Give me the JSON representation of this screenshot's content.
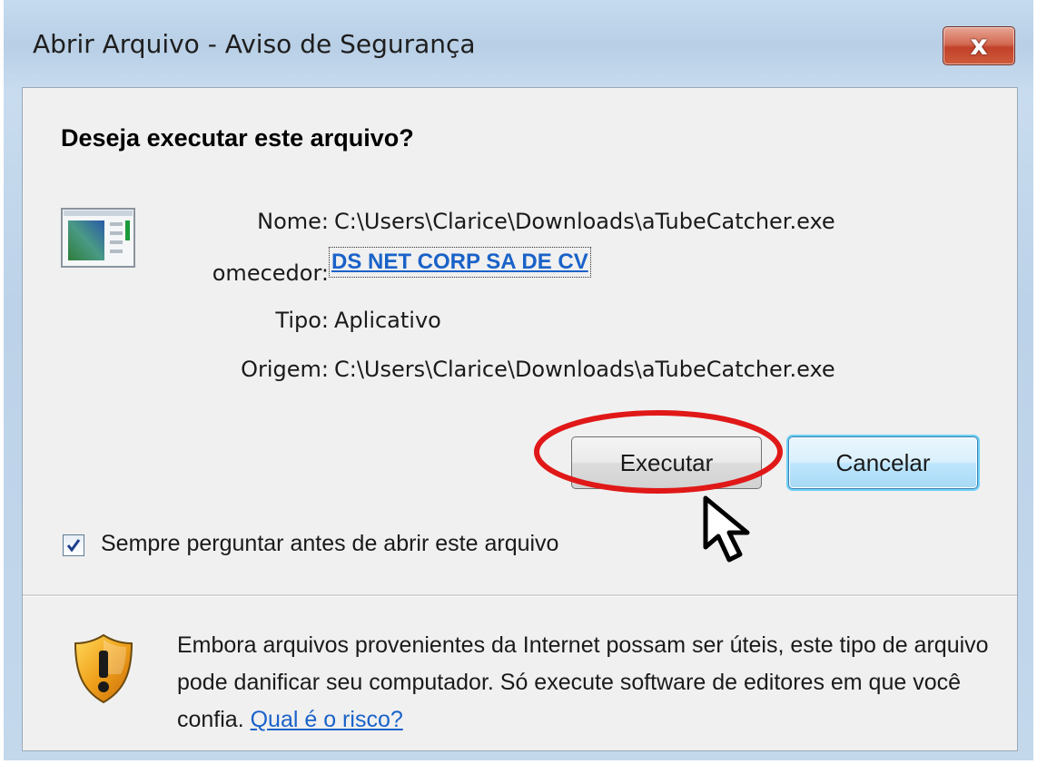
{
  "window": {
    "title": "Abrir Arquivo - Aviso de Segurança",
    "close_label": "x"
  },
  "dialog": {
    "question": "Deseja executar este arquivo?",
    "fields": [
      {
        "label": "Nome:",
        "value": "C:\\Users\\Clarice\\Downloads\\aTubeCatcher.exe"
      },
      {
        "label": "omecedor:",
        "value": "DS NET CORP SA DE CV"
      },
      {
        "label": "Tipo:",
        "value": "Aplicativo"
      },
      {
        "label": "Origem:",
        "value": "C:\\Users\\Clarice\\Downloads\\aTubeCatcher.exe"
      }
    ],
    "buttons": {
      "run_label": "Executar",
      "cancel_label": "Cancelar"
    },
    "checkbox": {
      "label": "Sempre perguntar antes de abrir este arquivo",
      "checked": true
    },
    "warning": {
      "text": "Embora arquivos provenientes da Internet possam ser úteis, este tipo de arquivo pode danificar seu computador. Só execute software de editores em que você confia. ",
      "link_label": "Qual é o risco?"
    }
  },
  "icons": {
    "app": "application-icon",
    "shield": "warning-shield-icon",
    "cursor": "mouse-cursor-icon",
    "check": "checkmark-icon"
  },
  "colors": {
    "link": "#1a62c8",
    "highlight_ellipse": "#e01818",
    "close_button": "#c1412a",
    "cancel_focus": "#6cd0f5"
  }
}
